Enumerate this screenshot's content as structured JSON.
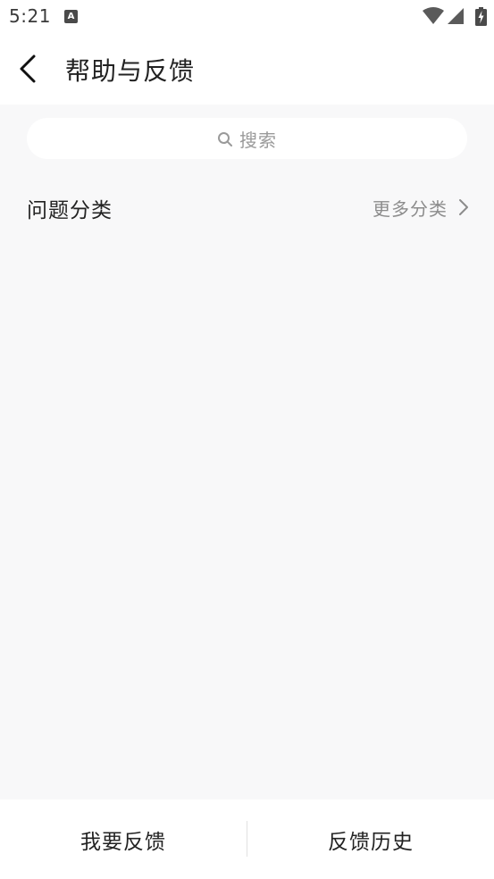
{
  "status_bar": {
    "time": "5:21",
    "notification_icon": "a-badge-icon",
    "notification_glyph": "A",
    "icons": [
      "wifi-icon",
      "signal-icon",
      "battery-charging-icon"
    ]
  },
  "header": {
    "back_icon": "chevron-left-icon",
    "title": "帮助与反馈"
  },
  "search": {
    "icon": "search-icon",
    "placeholder": "搜索"
  },
  "section": {
    "title": "问题分类",
    "more_label": "更多分类",
    "more_icon": "chevron-right-icon"
  },
  "bottom_bar": {
    "feedback_label": "我要反馈",
    "history_label": "反馈历史"
  },
  "colors": {
    "background": "#f8f8f9",
    "surface": "#ffffff",
    "text_primary": "#222222",
    "text_secondary": "#8c8c8c",
    "placeholder": "#9a9a9a"
  }
}
